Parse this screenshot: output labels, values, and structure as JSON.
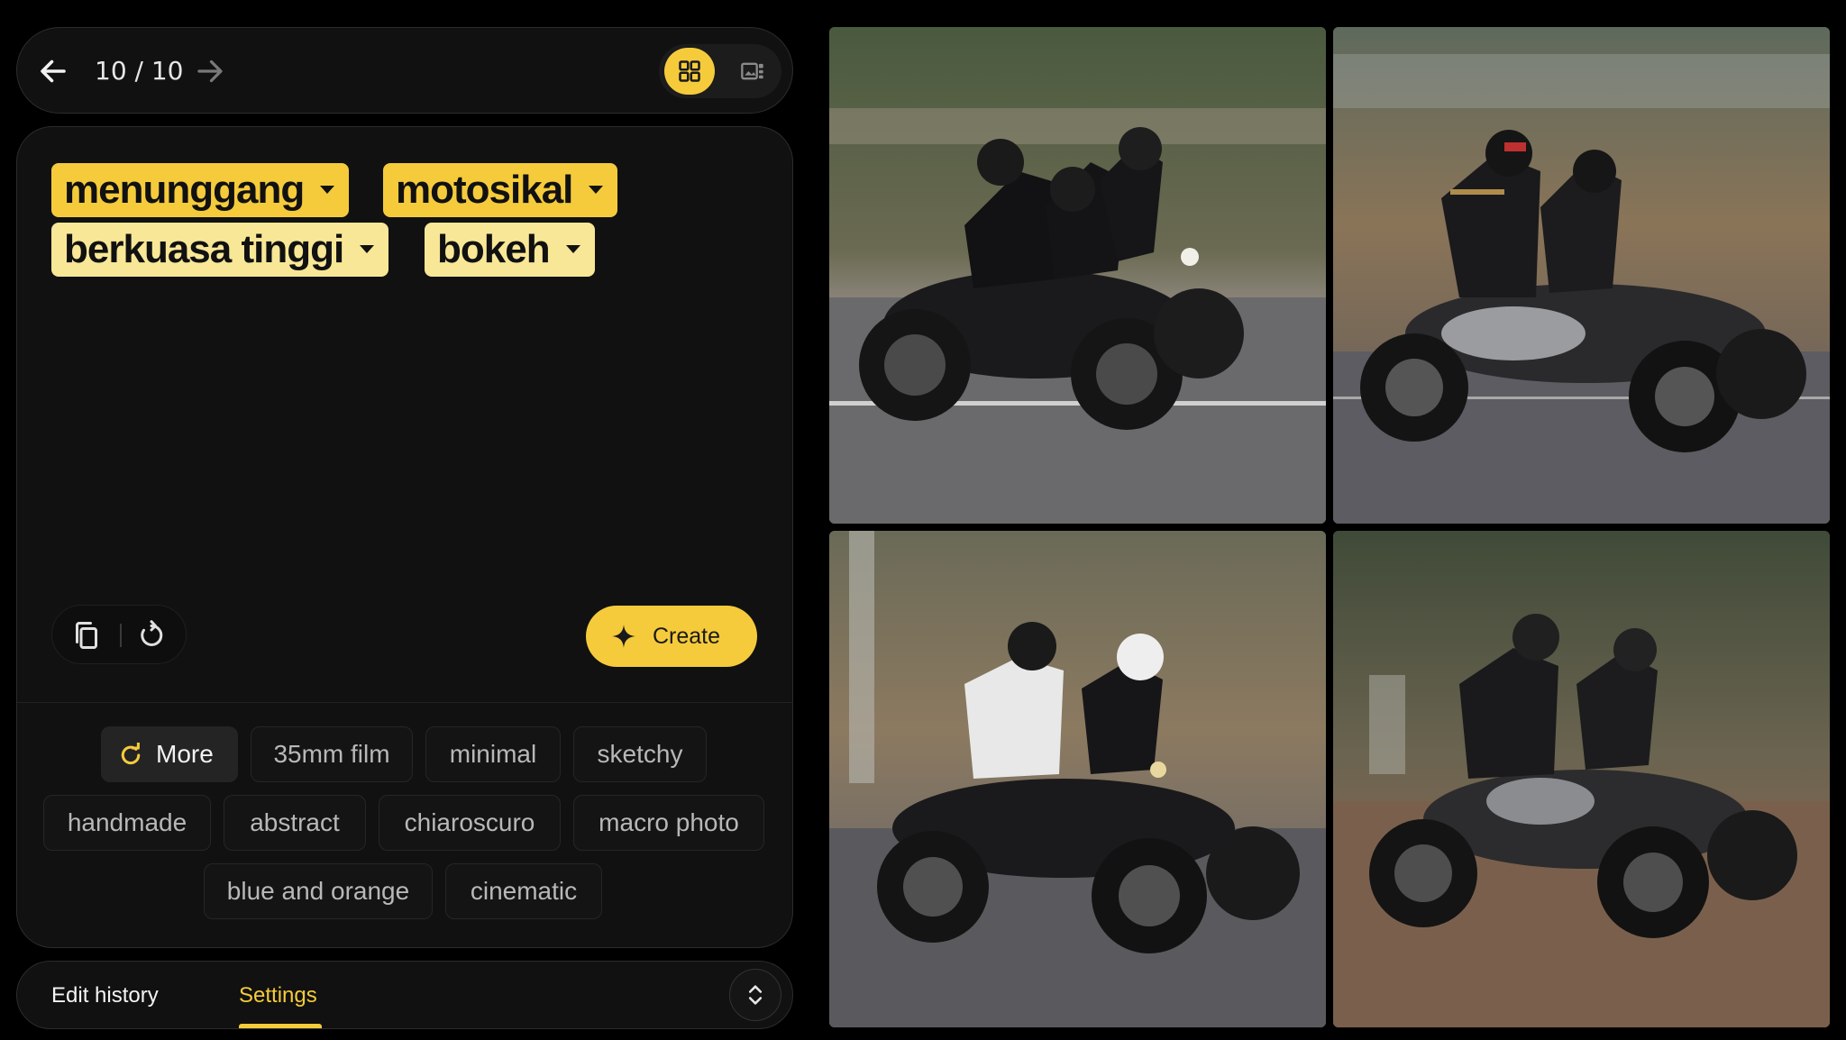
{
  "nav": {
    "counter": "10 / 10",
    "back_icon": "arrow-left-icon",
    "forward_icon": "arrow-right-icon",
    "views": [
      {
        "icon": "grid-view-icon",
        "selected": true
      },
      {
        "icon": "single-view-icon",
        "selected": false
      }
    ]
  },
  "prompt": {
    "chips": [
      {
        "text": "menunggang",
        "style": "yellow"
      },
      {
        "text": "motosikal",
        "style": "yellow"
      },
      {
        "text": "berkuasa tinggi",
        "style": "pale"
      },
      {
        "text": "bokeh",
        "style": "pale"
      }
    ],
    "tools": [
      "copy-icon",
      "reset-icon"
    ],
    "create_label": "Create"
  },
  "suggestions": {
    "more_label": "More",
    "chips": [
      "35mm film",
      "minimal",
      "sketchy",
      "handmade",
      "abstract",
      "chiaroscuro",
      "macro photo",
      "blue and orange",
      "cinematic"
    ]
  },
  "tabs": {
    "items": [
      {
        "label": "Edit history",
        "active": false
      },
      {
        "label": "Settings",
        "active": true
      }
    ],
    "expand_icon": "unfold-icon"
  },
  "images": [
    {
      "id": "image-1"
    },
    {
      "id": "image-2"
    },
    {
      "id": "image-3"
    },
    {
      "id": "image-4"
    }
  ],
  "colors": {
    "accent": "#f5cb3c",
    "accent_pale": "#f8e796",
    "panel": "#111111",
    "background": "#000000"
  }
}
